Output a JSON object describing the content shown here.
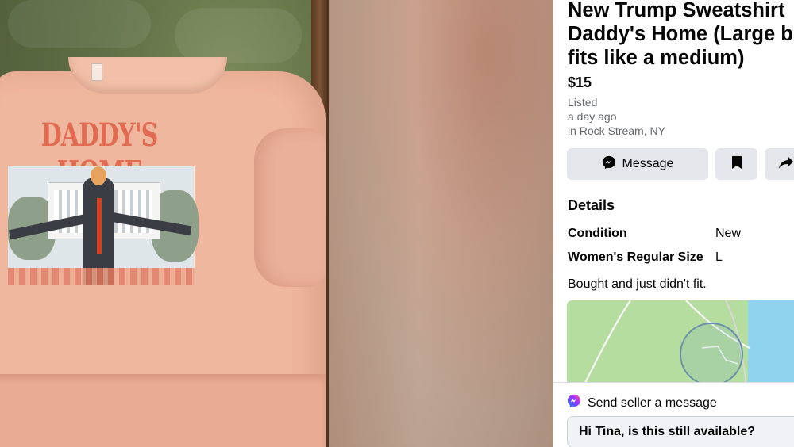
{
  "listing": {
    "title_line1": "New Trump Sweatshirt",
    "title_line2": "Daddy's Home (Large b",
    "title_line3": "fits like a medium)",
    "price": "$15",
    "listed_label": "Listed",
    "listed_time": "a day ago",
    "location": "in Rock Stream, NY"
  },
  "photo": {
    "shirt_print_text": "DADDY'S HOME",
    "shirt_color": "#efb79e",
    "print_text_color": "#e06a52"
  },
  "actions": {
    "message_label": "Message",
    "save_icon": "bookmark-icon",
    "share_icon": "share-icon",
    "messenger_icon": "messenger-icon"
  },
  "details": {
    "heading": "Details",
    "rows": [
      {
        "label": "Condition",
        "value": "New"
      },
      {
        "label": "Women's Regular Size",
        "value": "L"
      }
    ],
    "description": "Bought and just didn't fit."
  },
  "send_message": {
    "heading": "Send seller a message",
    "input_value": "Hi Tina, is this still available?"
  },
  "colors": {
    "button_bg": "#e4e6eb",
    "text_primary": "#050505",
    "text_secondary": "#65676b",
    "map_land": "#b4dd9f",
    "map_water": "#8fd3ef"
  }
}
